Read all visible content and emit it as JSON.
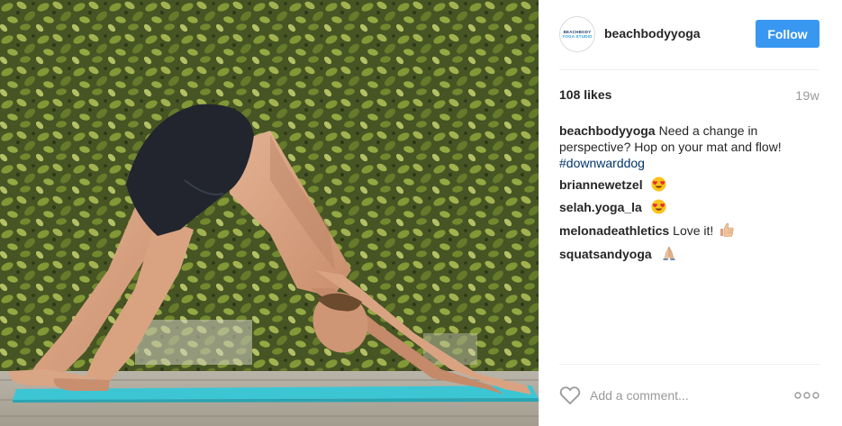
{
  "post": {
    "author": {
      "username": "beachbodyyoga",
      "avatar_text_top": "BEACHBODY",
      "avatar_text_bottom": "YOGA STUDIO"
    },
    "follow_label": "Follow",
    "likes": "108 likes",
    "time_ago": "19w",
    "caption": {
      "username": "beachbodyyoga",
      "text": "Need a change in perspective? Hop on your mat and flow!",
      "hashtag": "#downwarddog"
    },
    "comments": [
      {
        "username": "briannewetzel",
        "text": "",
        "emoji": "heart-eyes-emoji"
      },
      {
        "username": "selah.yoga_la",
        "text": "",
        "emoji": "heart-eyes-emoji"
      },
      {
        "username": "melonadeathletics",
        "text": "Love it!",
        "emoji": "thumbs-up-emoji"
      },
      {
        "username": "squatsandyoga",
        "text": "",
        "emoji": "praying-hands-emoji"
      }
    ],
    "add_comment_placeholder": "Add a comment...",
    "more_icon": "more-options-icon",
    "like_icon": "heart-outline-icon"
  },
  "colors": {
    "follow_button": "#3897f0",
    "hashtag": "#003569",
    "muted": "#999999",
    "yoga_mat": "#3cc6d4"
  }
}
